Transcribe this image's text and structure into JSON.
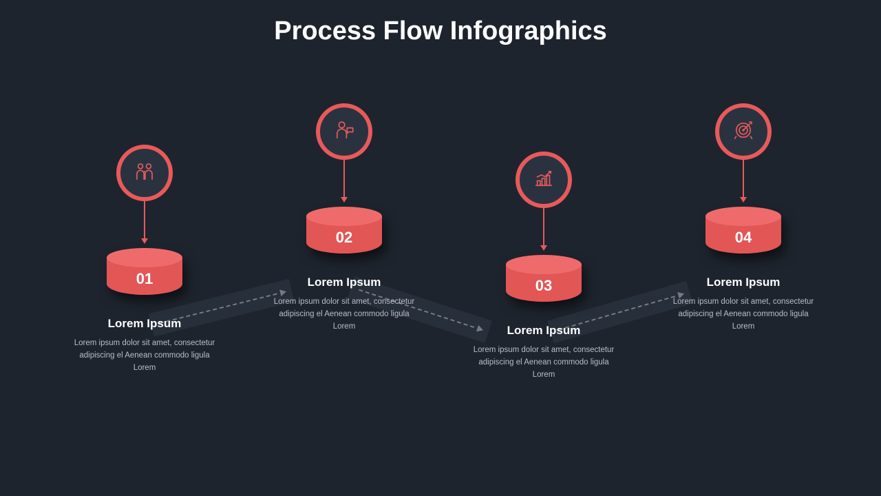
{
  "title": "Process Flow Infographics",
  "accent": "#e85a5a",
  "steps": [
    {
      "number": "01",
      "icon": "people-icon",
      "heading": "Lorem Ipsum",
      "desc": "Lorem ipsum dolor sit amet, consectetur adipiscing el Aenean commodo ligula Lorem"
    },
    {
      "number": "02",
      "icon": "person-speech-icon",
      "heading": "Lorem Ipsum",
      "desc": "Lorem ipsum dolor sit amet, consectetur adipiscing el Aenean commodo ligula Lorem"
    },
    {
      "number": "03",
      "icon": "growth-chart-icon",
      "heading": "Lorem Ipsum",
      "desc": "Lorem ipsum dolor sit amet, consectetur adipiscing el Aenean commodo ligula Lorem"
    },
    {
      "number": "04",
      "icon": "target-icon",
      "heading": "Lorem Ipsum",
      "desc": "Lorem ipsum dolor sit amet, consectetur adipiscing el Aenean commodo ligula Lorem"
    }
  ]
}
